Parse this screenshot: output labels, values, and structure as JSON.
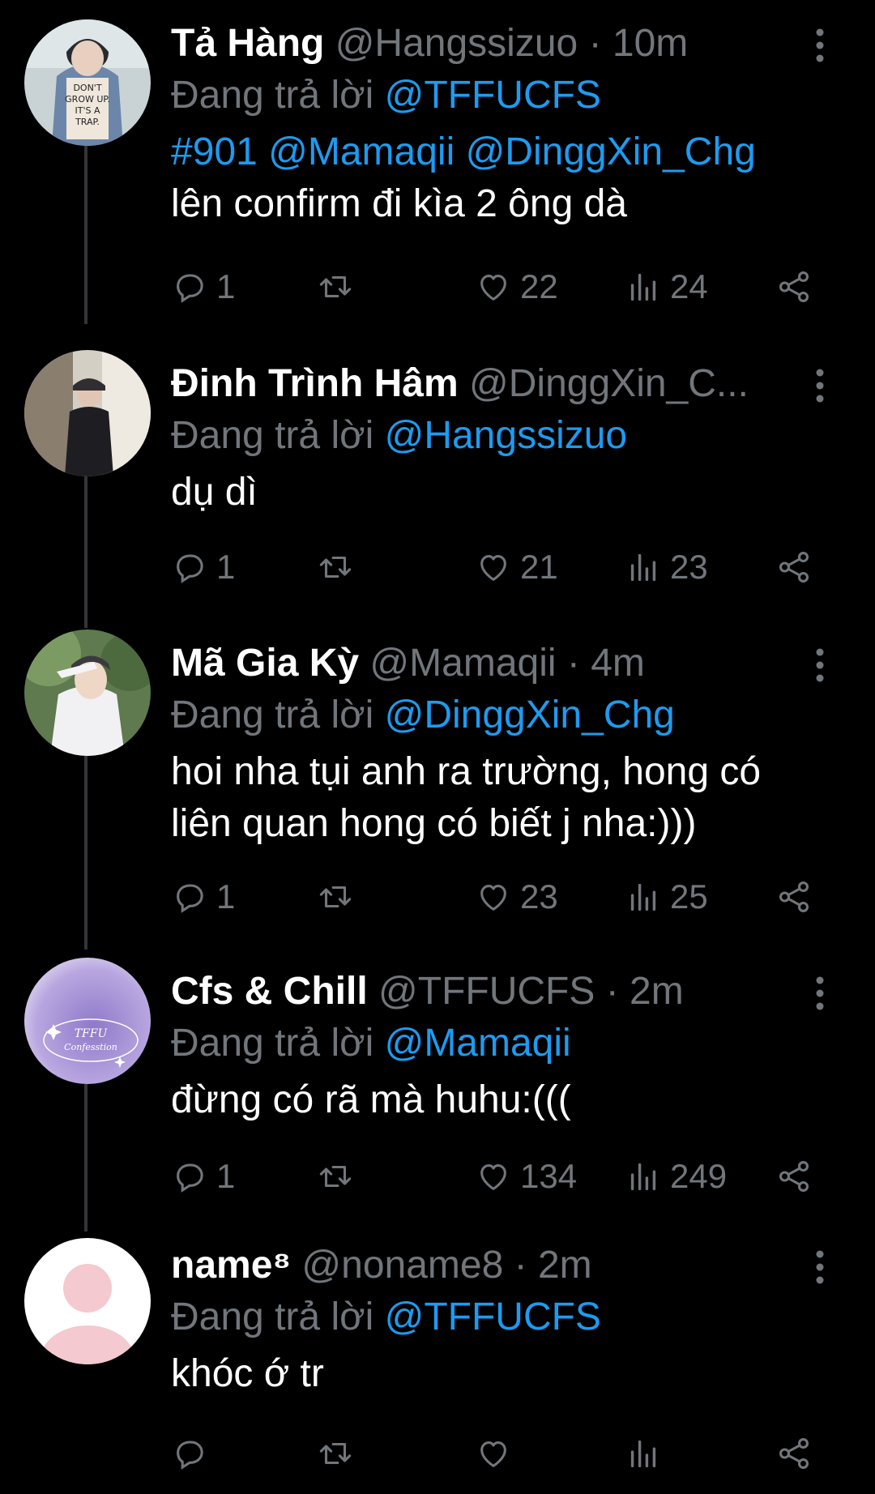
{
  "reply_prefix": "Đang trả lời",
  "colors": {
    "background": "#000000",
    "primary_text": "#ffffff",
    "secondary_text": "#71767b",
    "accent": "#1d9bf0",
    "thread_line": "#333639"
  },
  "tweets": [
    {
      "name": "Tả Hàng",
      "handle": "@Hangssizuo",
      "time": "10m",
      "reply_to": "@TFFUCFS",
      "body_mentions": "#901 @Mamaqii @DinggXin_Chg",
      "body": "lên confirm đi kìa 2 ông dà",
      "replies": "1",
      "likes": "22",
      "views": "24",
      "avatar_text": "DON'T GROW UP. IT'S A TRAP."
    },
    {
      "name": "Đinh Trình Hâm",
      "handle": "@DinggXin_C...",
      "time": "",
      "reply_to": "@Hangssizuo",
      "body": "dụ dì",
      "replies": "1",
      "likes": "21",
      "views": "23"
    },
    {
      "name": "Mã Gia Kỳ",
      "handle": "@Mamaqii",
      "time": "4m",
      "reply_to": "@DinggXin_Chg",
      "body": "hoi nha tụi anh ra trường, hong có liên quan hong có biết j nha:)))",
      "replies": "1",
      "likes": "23",
      "views": "25"
    },
    {
      "name": "Cfs & Chill",
      "handle": "@TFFUCFS",
      "time": "2m",
      "reply_to": "@Mamaqii",
      "body": "đừng có rã mà huhu:(((",
      "replies": "1",
      "likes": "134",
      "views": "249",
      "avatar_text": "TFFU Confesstion"
    },
    {
      "name": "name⁸",
      "handle": "@noname8",
      "time": "2m",
      "reply_to": "@TFFUCFS",
      "body": "khóc ớ tr",
      "replies": "",
      "likes": "",
      "views": ""
    }
  ],
  "icons": [
    "reply-icon",
    "retweet-icon",
    "like-icon",
    "views-icon",
    "share-icon",
    "more-icon"
  ]
}
